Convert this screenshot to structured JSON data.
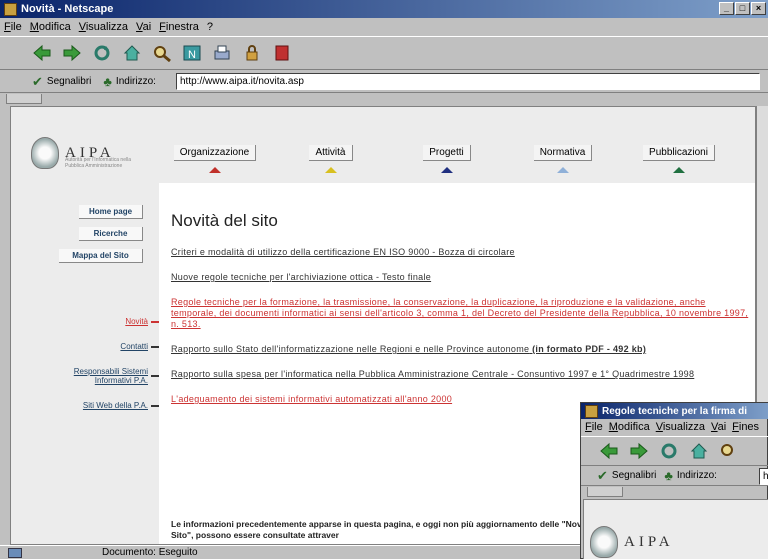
{
  "window": {
    "title": "Novità - Netscape",
    "controls": [
      "_",
      "□",
      "×"
    ]
  },
  "menu": [
    "File",
    "Modifica",
    "Visualizza",
    "Vai",
    "Finestra",
    "?"
  ],
  "toolbar": {
    "icons": [
      "back-icon",
      "forward-icon",
      "reload-icon",
      "home-icon",
      "search-icon",
      "netscape-icon",
      "print-icon",
      "security-icon",
      "stop-icon"
    ]
  },
  "location": {
    "bookmarks_label": "Segnalibri",
    "address_label": "Indirizzo:",
    "url": "http://www.aipa.it/novita.asp"
  },
  "page": {
    "logo": {
      "name": "AIPA",
      "tagline": "Autorità per l'Informatica nella Pubblica Amministrazione"
    },
    "nav": [
      {
        "label": "Organizzazione",
        "color": "#c0302a"
      },
      {
        "label": "Attività",
        "color": "#d8c020"
      },
      {
        "label": "Progetti",
        "color": "#203080"
      },
      {
        "label": "Normativa",
        "color": "#8fb0d8"
      },
      {
        "label": "Pubblicazioni",
        "color": "#207040"
      }
    ],
    "sidebar_buttons": [
      "Home page",
      "Ricerche",
      "Mappa del Sito"
    ],
    "side_links": [
      "Novità",
      "Contatti",
      "Responsabili Sistemi Informativi P.A.",
      "Siti Web della P.A."
    ],
    "heading": "Novità del sito",
    "news": [
      {
        "text": "Criteri e modalità di utilizzo della certificazione EN ISO 9000 - Bozza di circolare",
        "extra": ""
      },
      {
        "text": "Nuove regole tecniche per l'archiviazione ottica - Testo finale",
        "extra": ""
      },
      {
        "text": "Regole tecniche per la formazione, la trasmissione, la conservazione, la duplicazione, la riproduzione e la validazione, anche temporale, dei documenti informatici ai sensi dell'articolo 3, comma 1, del Decreto del Presidente della Repubblica, 10 novembre 1997, n. 513.",
        "extra": ""
      },
      {
        "text": "Rapporto sullo Stato dell'informatizzazione nelle Regioni e nelle Province autonome",
        "extra": " (in formato PDF - 492 kb)"
      },
      {
        "text": "Rapporto sulla spesa per l'informatica nella Pubblica Amministrazione Centrale - Consuntivo 1997 e 1° Quadrimestre 1998",
        "extra": ""
      },
      {
        "text": "L'adeguamento dei sistemi informativi automatizzati all'anno 2000",
        "extra": ""
      }
    ],
    "footnote": "Le informazioni precedentemente apparse in questa pagina, e oggi non più aggiornamento delle \"Novità del Sito\", possono essere consultate attraver"
  },
  "status": {
    "text": "Documento: Eseguito"
  },
  "second_window": {
    "title": "Regole tecniche per la firma di",
    "menu": [
      "File",
      "Modifica",
      "Visualizza",
      "Vai",
      "Fines"
    ],
    "bookmarks_label": "Segnalibri",
    "address_label": "Indirizzo:",
    "url": "h",
    "logo": "AIPA"
  }
}
